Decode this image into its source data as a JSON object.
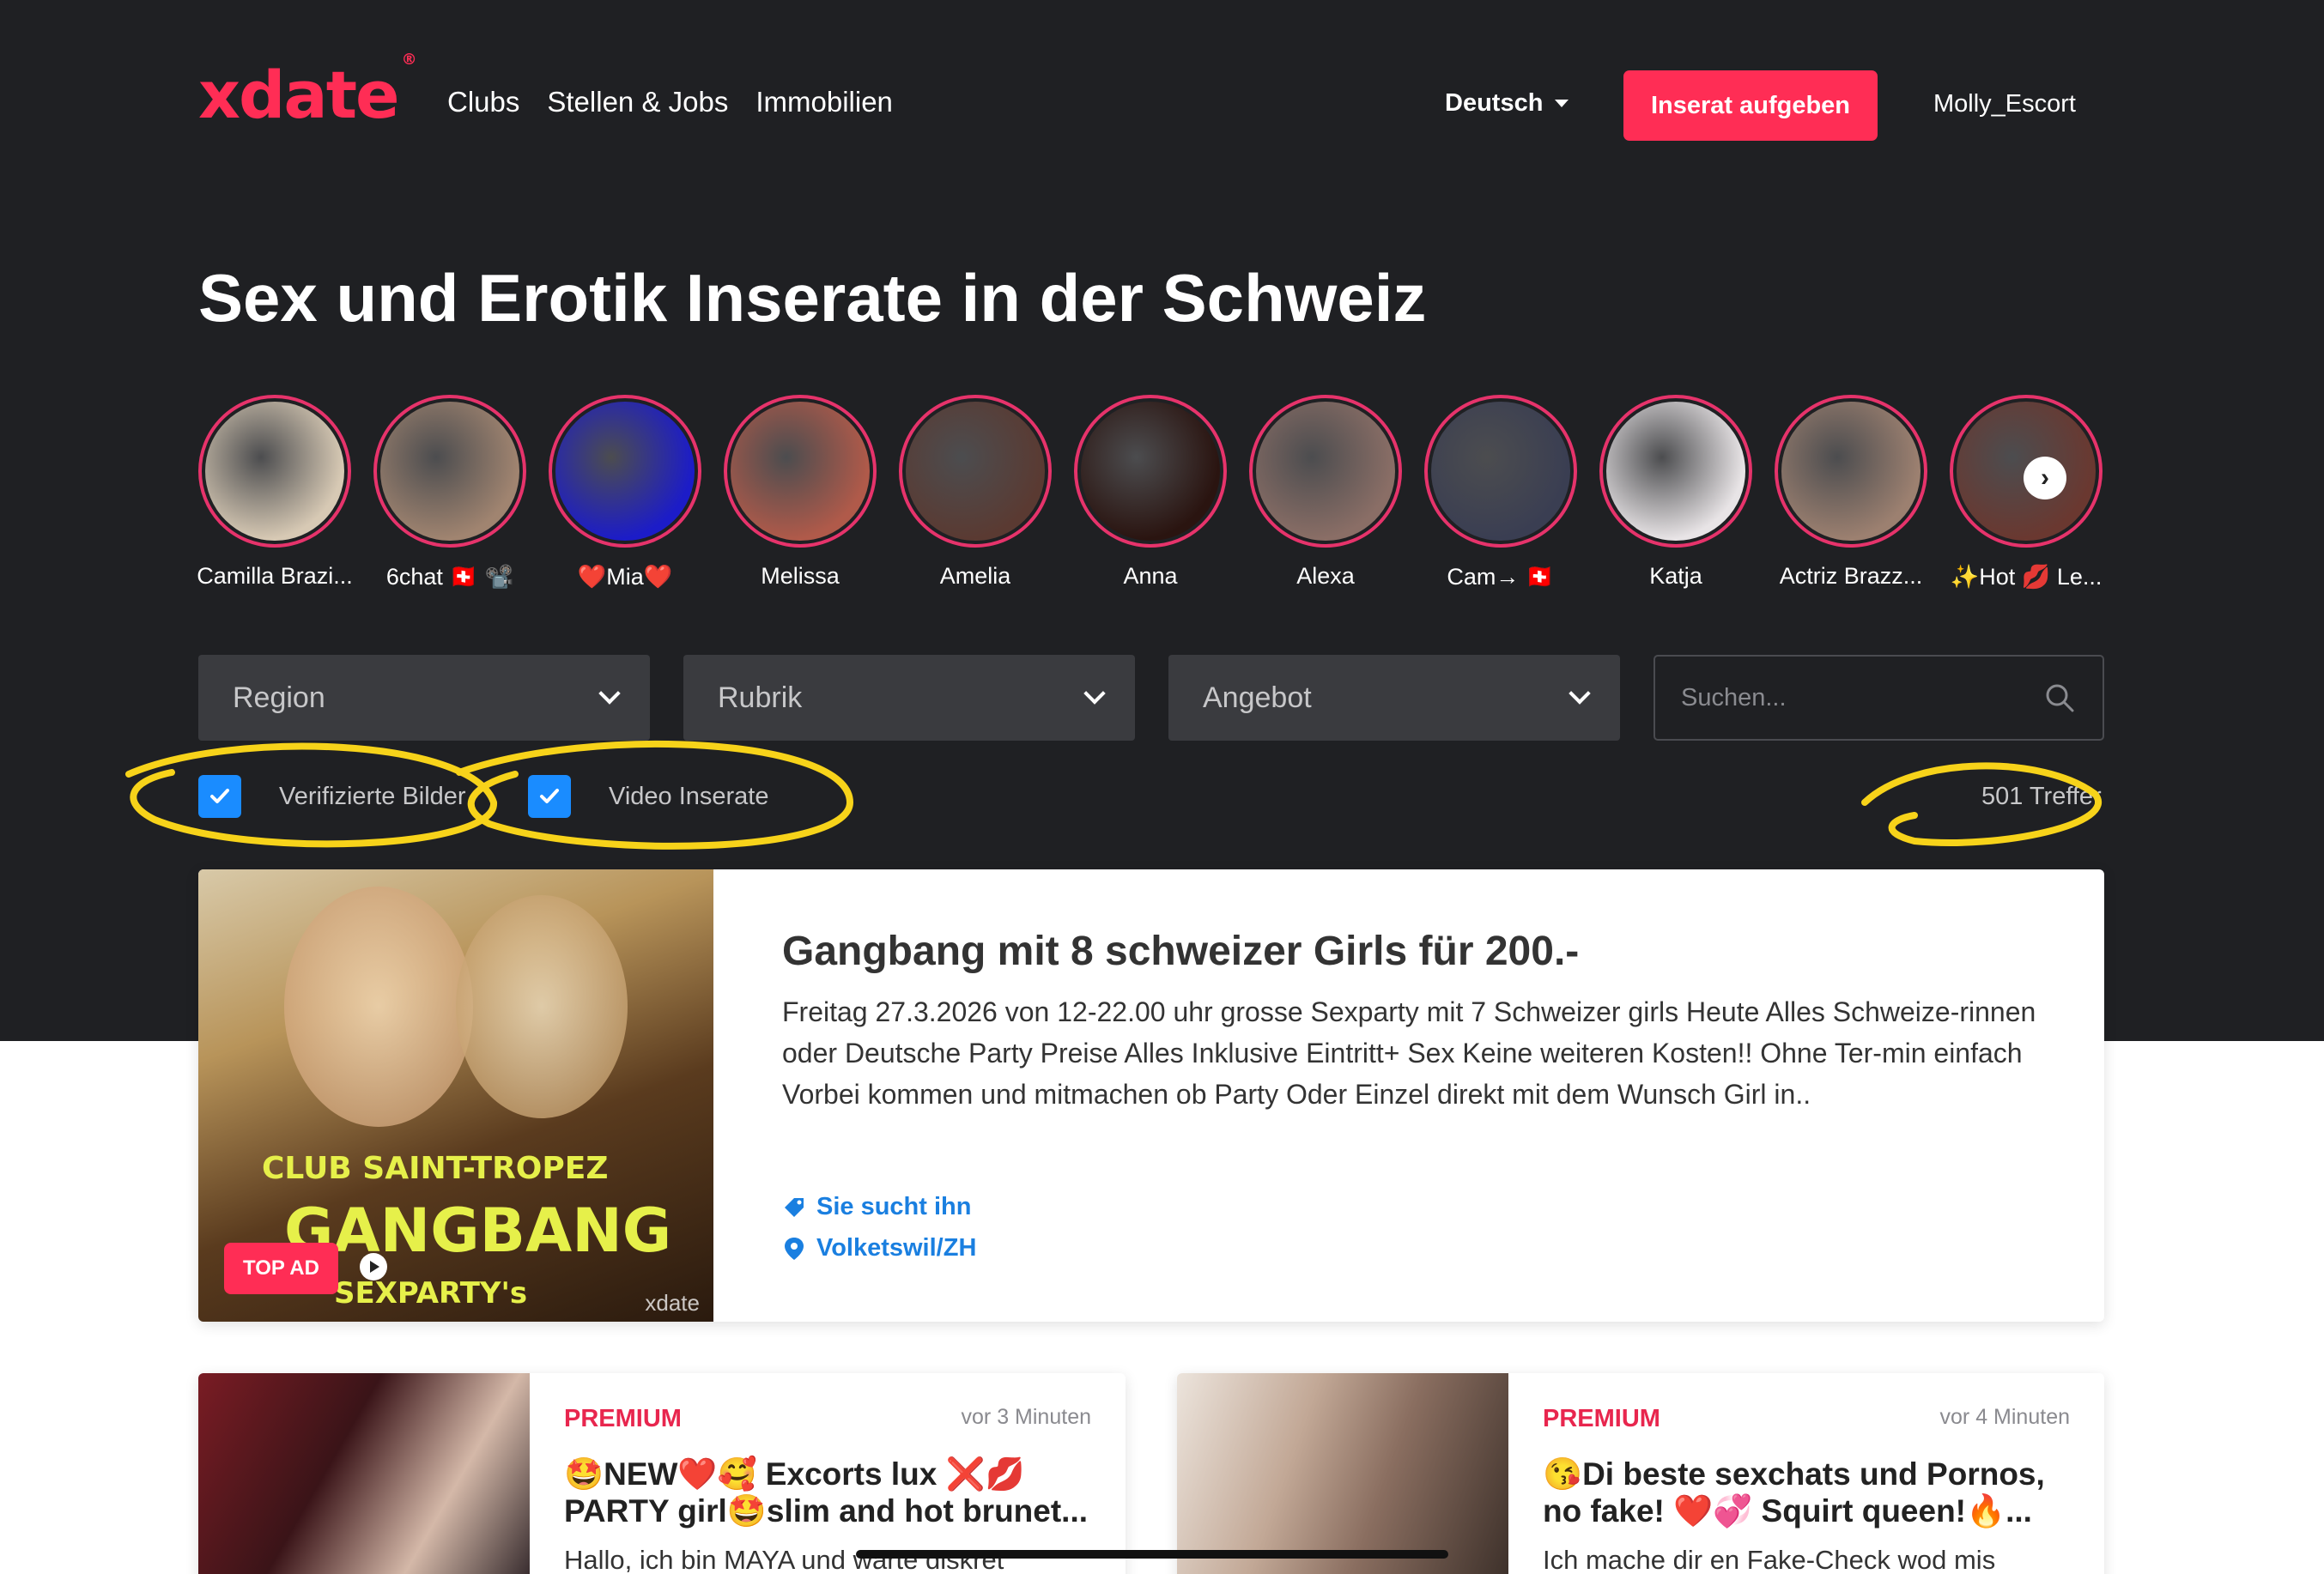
{
  "header": {
    "logo": "xdate",
    "logo_mark": "®",
    "nav": [
      "Clubs",
      "Stellen & Jobs",
      "Immobilien"
    ],
    "language": "Deutsch",
    "cta": "Inserat aufgeben",
    "user": "Molly_Escort"
  },
  "page_title": "Sex und Erotik Inserate in der Schweiz",
  "stories": [
    {
      "name": "Camilla Brazi...",
      "color": "#d7c9b4"
    },
    {
      "name": "6chat 🇨🇭 📽️",
      "color": "#a08470"
    },
    {
      "name": "❤️Mia❤️",
      "color": "#1c1cc8"
    },
    {
      "name": "Melissa",
      "color": "#b05a4a"
    },
    {
      "name": "Amelia",
      "color": "#5a3a32"
    },
    {
      "name": "Anna",
      "color": "#2a1410"
    },
    {
      "name": "Alexa",
      "color": "#8a6e66"
    },
    {
      "name": "Cam→ 🇨🇭",
      "color": "#3a3e52"
    },
    {
      "name": "Katja",
      "color": "#e8e4e6"
    },
    {
      "name": "Actriz Brazz...",
      "color": "#9c8070"
    },
    {
      "name": "✨Hot 💋 Le...",
      "color": "#6a3830"
    }
  ],
  "filters": {
    "region": "Region",
    "rubrik": "Rubrik",
    "angebot": "Angebot",
    "search_placeholder": "Suchen..."
  },
  "checkboxes": {
    "verified": "Verifizierte Bilder",
    "video": "Video Inserate"
  },
  "result_count": "501 Treffer",
  "top_ad": {
    "badge": "TOP AD",
    "image_text": {
      "club": "CLUB SAINT-TROPEZ",
      "gang": "GANGBANG",
      "sex": "SEXPARTY's",
      "watermark": "xdate"
    },
    "title": "Gangbang mit 8 schweizer Girls für 200.-",
    "description": "Freitag 27.3.2026 von 12-22.00 uhr grosse Sexparty mit 7 Schweizer girls Heute Alles Schweize-rinnen oder Deutsche Party Preise Alles Inklusive Eintritt+ Sex Keine weiteren Kosten!! Ohne Ter-min einfach Vorbei kommen und mitmachen ob Party Oder Einzel direkt mit dem Wunsch Girl in..",
    "category": "Sie sucht ihn",
    "location": "Volketswil/ZH"
  },
  "listings": [
    {
      "tag": "PREMIUM",
      "time": "vor 3 Minuten",
      "title": "🤩NEW❤️🥰 Excorts lux ❌💋 PARTY girl🤩slim and hot brunet...",
      "description": "Hallo, ich bin MAYA und warte diskret",
      "photo_color": "#5a2a2e"
    },
    {
      "tag": "PREMIUM",
      "time": "vor 4 Minuten",
      "title": "😘Di beste sexchats und Pornos, no fake! ❤️💞 Squirt queen!🔥...",
      "description": "Ich mache dir en Fake-Check wod mis",
      "photo_color": "#8a7a70"
    }
  ],
  "colors": {
    "brand": "#ff2d55",
    "dark_bg": "#1f2023",
    "link": "#1a7fe0",
    "checkbox": "#1a8cff",
    "highlighter": "#f7d31a"
  }
}
